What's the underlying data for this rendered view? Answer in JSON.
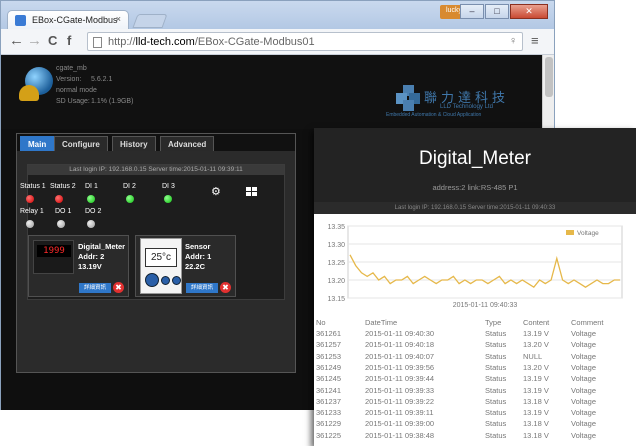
{
  "browser": {
    "tab_title": "EBox-CGate-Modbus",
    "tab_close": "×",
    "user_badge": "lucky",
    "win_min": "–",
    "win_max": "□",
    "win_close": "✕",
    "back": "←",
    "forward": "→",
    "reload": "C",
    "home": "f",
    "url_proto": "http://",
    "url_domain": "lld-tech.com",
    "url_path": "/EBox-CGate-Modbus01"
  },
  "device": {
    "name": "cgate_mb",
    "version_label": "Version:",
    "version": "5.6.2.1",
    "mode": "normal mode",
    "sd_label": "SD Usage:",
    "sd_value": "1.1% (1.9GB)"
  },
  "brand": {
    "name": "聯力達科技",
    "sub1": "LLD Technology Ltd",
    "sub2": "Embedded Automation & Cloud Application"
  },
  "panel": {
    "tabs": [
      "Main",
      "Configure",
      "History",
      "Advanced"
    ],
    "login_line": "Last login IP: 192.168.0.15 Server time:2015-01-11 09:39:11",
    "io": [
      {
        "label": "Status 1",
        "state": "red"
      },
      {
        "label": "Status 2",
        "state": "red"
      },
      {
        "label": "DI 1",
        "state": "green"
      },
      {
        "label": "DI 2",
        "state": "green"
      },
      {
        "label": "DI 3",
        "state": "green"
      },
      {
        "label": "Relay 1",
        "state": "gray"
      },
      {
        "label": "DO 1",
        "state": "gray"
      },
      {
        "label": "DO 2",
        "state": "gray"
      }
    ],
    "cards": [
      {
        "display": "1999",
        "name": "Digital_Meter",
        "addr": "Addr: 2",
        "value": "13.19V",
        "detail": "詳細資訊",
        "delete": "✖"
      },
      {
        "display": "25°c",
        "name": "Sensor",
        "addr": "Addr: 1",
        "value": "22.2C",
        "detail": "詳細資訊",
        "delete": "✖"
      }
    ]
  },
  "overlay": {
    "title": "Digital_Meter",
    "address": "address:2 link:RS-485 P1",
    "login_line": "Last login IP: 192.168.0.15 Server time:2015-01-11 09:40:33",
    "table_headers": [
      "No",
      "DateTime",
      "Type",
      "Content",
      "Comment"
    ],
    "rows": [
      [
        "361261",
        "2015-01-11 09:40:30",
        "Status",
        "13.19 V",
        "Voltage"
      ],
      [
        "361257",
        "2015-01-11 09:40:18",
        "Status",
        "13.20 V",
        "Voltage"
      ],
      [
        "361253",
        "2015-01-11 09:40:07",
        "Status",
        "NULL",
        "Voltage"
      ],
      [
        "361249",
        "2015-01-11 09:39:56",
        "Status",
        "13.20 V",
        "Voltage"
      ],
      [
        "361245",
        "2015-01-11 09:39:44",
        "Status",
        "13.19 V",
        "Voltage"
      ],
      [
        "361241",
        "2015-01-11 09:39:33",
        "Status",
        "13.19 V",
        "Voltage"
      ],
      [
        "361237",
        "2015-01-11 09:39:22",
        "Status",
        "13.18 V",
        "Voltage"
      ],
      [
        "361233",
        "2015-01-11 09:39:11",
        "Status",
        "13.19 V",
        "Voltage"
      ],
      [
        "361229",
        "2015-01-11 09:39:00",
        "Status",
        "13.18 V",
        "Voltage"
      ],
      [
        "361225",
        "2015-01-11 09:38:48",
        "Status",
        "13.18 V",
        "Voltage"
      ]
    ]
  },
  "chart_data": {
    "type": "line",
    "series": [
      {
        "name": "Voltage",
        "color": "#e6b84a",
        "values": [
          13.27,
          13.24,
          13.22,
          13.21,
          13.22,
          13.2,
          13.21,
          13.19,
          13.2,
          13.2,
          13.21,
          13.19,
          13.2,
          13.21,
          13.2,
          13.19,
          13.2,
          13.2,
          13.21,
          13.19,
          13.2,
          13.19,
          13.2,
          13.2,
          13.19,
          13.2,
          13.21,
          13.19,
          13.2,
          13.19,
          13.2,
          13.19,
          13.18,
          13.2,
          13.19,
          13.2,
          13.26,
          13.2,
          13.19,
          13.2,
          13.19,
          13.18,
          13.19,
          13.2,
          13.19,
          13.19,
          13.2,
          13.2
        ]
      }
    ],
    "ylim": [
      13.15,
      13.35
    ],
    "yticks": [
      "13.35",
      "13.30",
      "13.25",
      "13.20",
      "13.15"
    ],
    "x_label": "2015-01-11 09:40:33",
    "legend_position": "top-right",
    "grid": true
  }
}
